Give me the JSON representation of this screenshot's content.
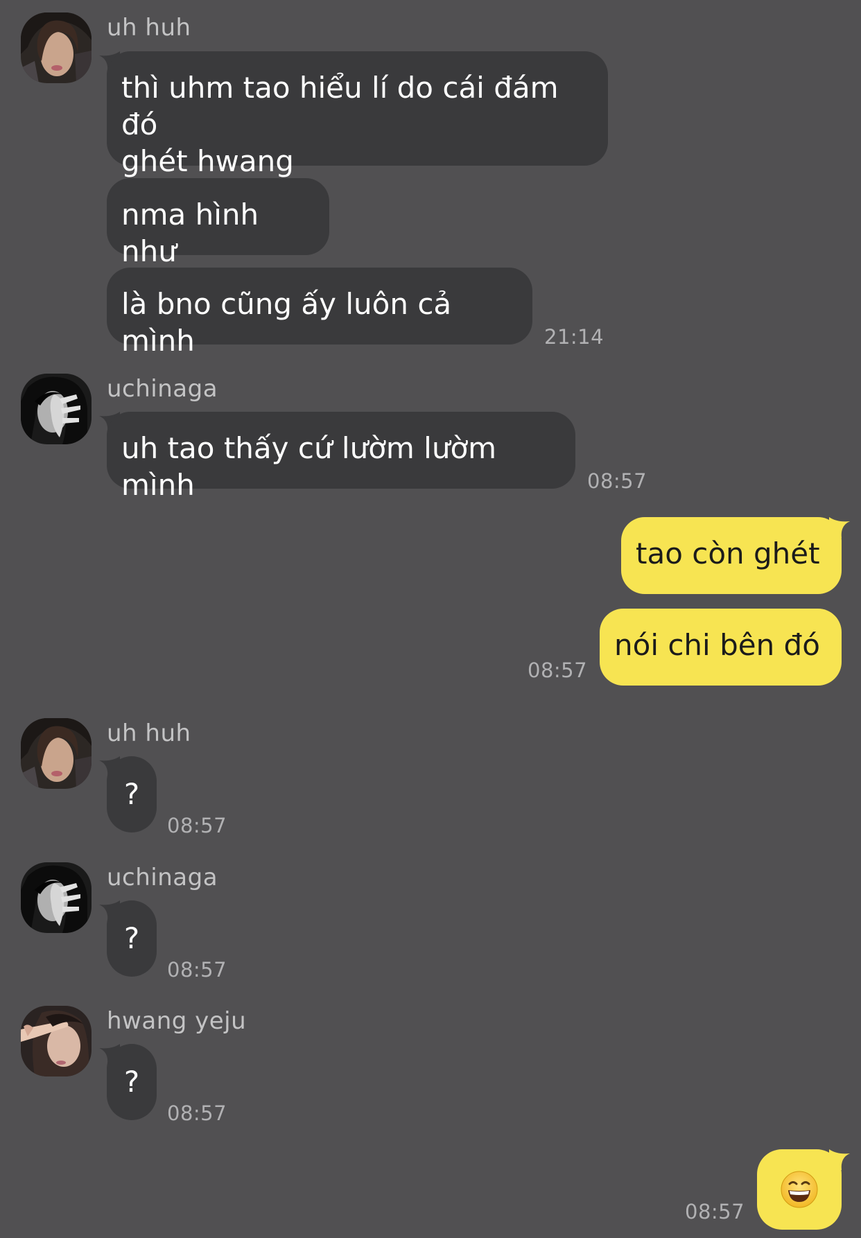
{
  "messages": [
    {
      "sender": "uh huh",
      "bubbles": [
        "thì uhm tao hiểu lí do cái đám đó\nghét hwang",
        "nma hình như",
        "là bno cũng ấy luôn cả mình"
      ],
      "time": "21:14"
    },
    {
      "sender": "uchinaga",
      "bubbles": [
        "uh tao thấy cứ lườm lườm mình"
      ],
      "time": "08:57"
    },
    {
      "self": true,
      "bubbles": [
        "tao còn ghét",
        "nói chi bên đó"
      ],
      "time": "08:57"
    },
    {
      "sender": "uh huh",
      "bubbles": [
        "?"
      ],
      "time": "08:57"
    },
    {
      "sender": "uchinaga",
      "bubbles": [
        "?"
      ],
      "time": "08:57"
    },
    {
      "sender": "hwang yeju",
      "bubbles": [
        "?"
      ],
      "time": "08:57"
    },
    {
      "self": true,
      "emoji": "grinning-squinting-face",
      "time": "08:57"
    }
  ],
  "colors": {
    "background": "#515052",
    "incoming_bubble": "#3a3a3c",
    "outgoing_bubble": "#f7e452",
    "timestamp": "#b1b1b3",
    "sender_name": "#c3c3c4"
  }
}
